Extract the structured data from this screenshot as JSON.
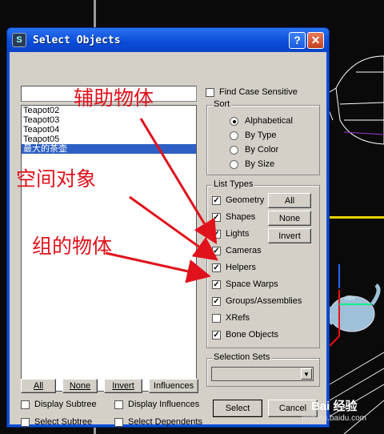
{
  "dialog": {
    "title": "Select Objects",
    "help_symbol": "?",
    "close_symbol": "✕"
  },
  "search": {
    "value": "",
    "placeholder": ""
  },
  "objects": [
    {
      "name": "Teapot02",
      "selected": false
    },
    {
      "name": "Teapot03",
      "selected": false
    },
    {
      "name": "Teapot04",
      "selected": false
    },
    {
      "name": "Teapot05",
      "selected": false
    },
    {
      "name": "最大的茶壶",
      "selected": true
    }
  ],
  "options": {
    "find_case_sensitive": "Find Case Sensitive",
    "find_case_checked": false
  },
  "sort": {
    "legend": "Sort",
    "items": [
      {
        "label": "Alphabetical",
        "checked": true
      },
      {
        "label": "By Type",
        "checked": false
      },
      {
        "label": "By Color",
        "checked": false
      },
      {
        "label": "By Size",
        "checked": false
      }
    ]
  },
  "list_types": {
    "legend": "List Types",
    "items": [
      {
        "label": "Geometry",
        "checked": true
      },
      {
        "label": "Shapes",
        "checked": true
      },
      {
        "label": "Lights",
        "checked": true
      },
      {
        "label": "Cameras",
        "checked": true
      },
      {
        "label": "Helpers",
        "checked": true
      },
      {
        "label": "Space Warps",
        "checked": true
      },
      {
        "label": "Groups/Assemblies",
        "checked": true
      },
      {
        "label": "XRefs",
        "checked": false
      },
      {
        "label": "Bone Objects",
        "checked": true
      }
    ],
    "all_label": "All",
    "none_label": "None",
    "invert_label": "Invert"
  },
  "selection_sets": {
    "legend": "Selection Sets",
    "value": ""
  },
  "bottom_buttons": {
    "all": "All",
    "none": "None",
    "invert": "Invert",
    "influences": "Influences"
  },
  "bottom_checks": {
    "display_subtree": "Display Subtree",
    "display_influences": "Display Influences",
    "select_subtree": "Select Subtree",
    "select_dependents": "Select Dependents"
  },
  "actions": {
    "select": "Select",
    "cancel": "Cancel"
  },
  "annotations": {
    "helper_objects": "辅助物体",
    "space_objects": "空间对象",
    "group_objects": "组的物体"
  },
  "watermark": {
    "brand": "Bai 经验",
    "url": "jingyan.baidu.com"
  },
  "colors": {
    "annotation": "#e0121c",
    "titlebar": "#0b4bd8",
    "selection": "#2d5fc4"
  }
}
